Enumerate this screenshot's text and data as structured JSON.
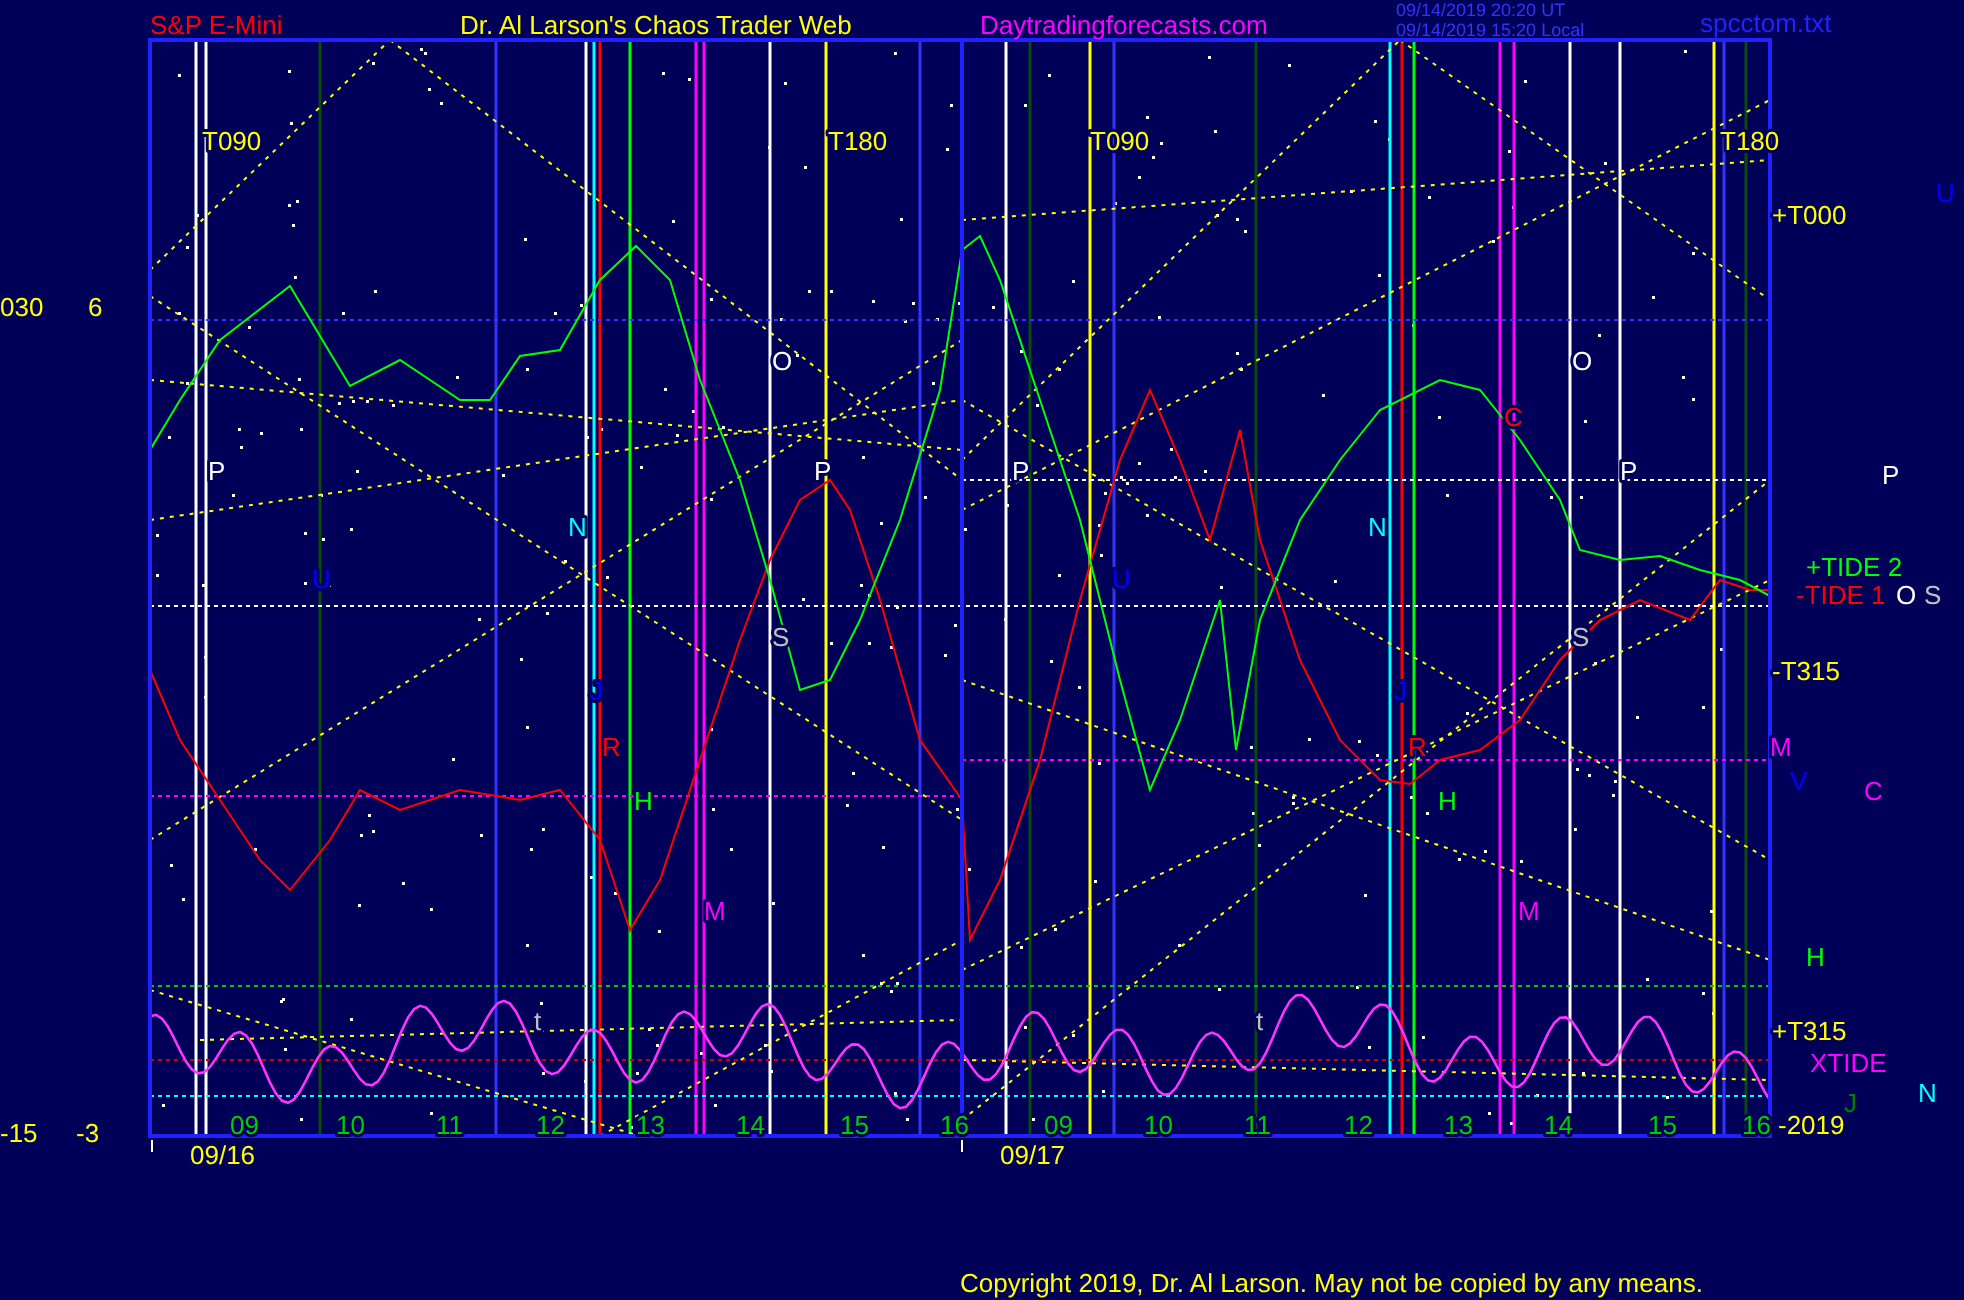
{
  "header": {
    "instrument": "S&P E-Mini",
    "title": "Dr. Al Larson's Chaos Trader Web",
    "website": "Daytradingforecasts.com",
    "timestamp_ut": "09/14/2019 20:20  UT",
    "timestamp_local": "09/14/2019 15:20  Local",
    "file": "spcctom.txt"
  },
  "axis_labels": [
    "030",
    "6",
    "-15",
    "-3"
  ],
  "chart_labels": [
    {
      "text": "T090",
      "color": "#ffff00"
    },
    {
      "text": "T180",
      "color": "#ffff00"
    },
    {
      "text": "T090",
      "color": "#ffff00"
    },
    {
      "text": "T180",
      "color": "#ffff00"
    },
    {
      "text": "O",
      "color": "#ffffff"
    },
    {
      "text": "O",
      "color": "#ffffff"
    },
    {
      "text": "P",
      "color": "#ffffff"
    },
    {
      "text": "P",
      "color": "#ffffff"
    },
    {
      "text": "P",
      "color": "#ffffff"
    },
    {
      "text": "P",
      "color": "#ffffff"
    },
    {
      "text": "N",
      "color": "#00ffff"
    },
    {
      "text": "N",
      "color": "#00ffff"
    },
    {
      "text": "U",
      "color": "#0000ff"
    },
    {
      "text": "U",
      "color": "#0000ff"
    },
    {
      "text": "S",
      "color": "#c0c0c0"
    },
    {
      "text": "S",
      "color": "#c0c0c0"
    },
    {
      "text": "C",
      "color": "#ff0000"
    },
    {
      "text": "J",
      "color": "#0000ff"
    },
    {
      "text": "J",
      "color": "#0000ff"
    },
    {
      "text": "R",
      "color": "#ff0000"
    },
    {
      "text": "R",
      "color": "#ff0000"
    },
    {
      "text": "H",
      "color": "#00ff00"
    },
    {
      "text": "H",
      "color": "#00ff00"
    },
    {
      "text": "M",
      "color": "#ff00ff"
    },
    {
      "text": "M",
      "color": "#ff00ff"
    },
    {
      "text": "t",
      "color": "#c0c0c0"
    },
    {
      "text": "t",
      "color": "#c0c0c0"
    }
  ],
  "right_labels": [
    {
      "text": "+T000",
      "color": "#ffff00"
    },
    {
      "text": "U",
      "color": "#0000ff"
    },
    {
      "text": "P",
      "color": "#ffffff"
    },
    {
      "text": "+TIDE 2",
      "color": "#00ff00"
    },
    {
      "text": "-TIDE 1",
      "color": "#ff0000"
    },
    {
      "text": "O",
      "color": "#ffffff"
    },
    {
      "text": "S",
      "color": "#c0c0c0"
    },
    {
      "text": "-T315",
      "color": "#ffff00"
    },
    {
      "text": "M",
      "color": "#ff00ff"
    },
    {
      "text": "V",
      "color": "#0000ff"
    },
    {
      "text": "C",
      "color": "#ff00ff"
    },
    {
      "text": "H",
      "color": "#00ff00"
    },
    {
      "text": "+T315",
      "color": "#ffff00"
    },
    {
      "text": "XTIDE",
      "color": "#ff00ff"
    },
    {
      "text": "J",
      "color": "#008000"
    },
    {
      "text": "N",
      "color": "#00ffff"
    },
    {
      "text": "-2019",
      "color": "#ffff00"
    }
  ],
  "time_axis": {
    "hours": [
      "09",
      "10",
      "11",
      "12",
      "13",
      "14",
      "15",
      "16",
      "09",
      "10",
      "11",
      "12",
      "13",
      "14",
      "15",
      "16"
    ],
    "dates": [
      "09/16",
      "09/17"
    ]
  },
  "copyright": "Copyright 2019, Dr. Al Larson. May not be copied by any means."
}
